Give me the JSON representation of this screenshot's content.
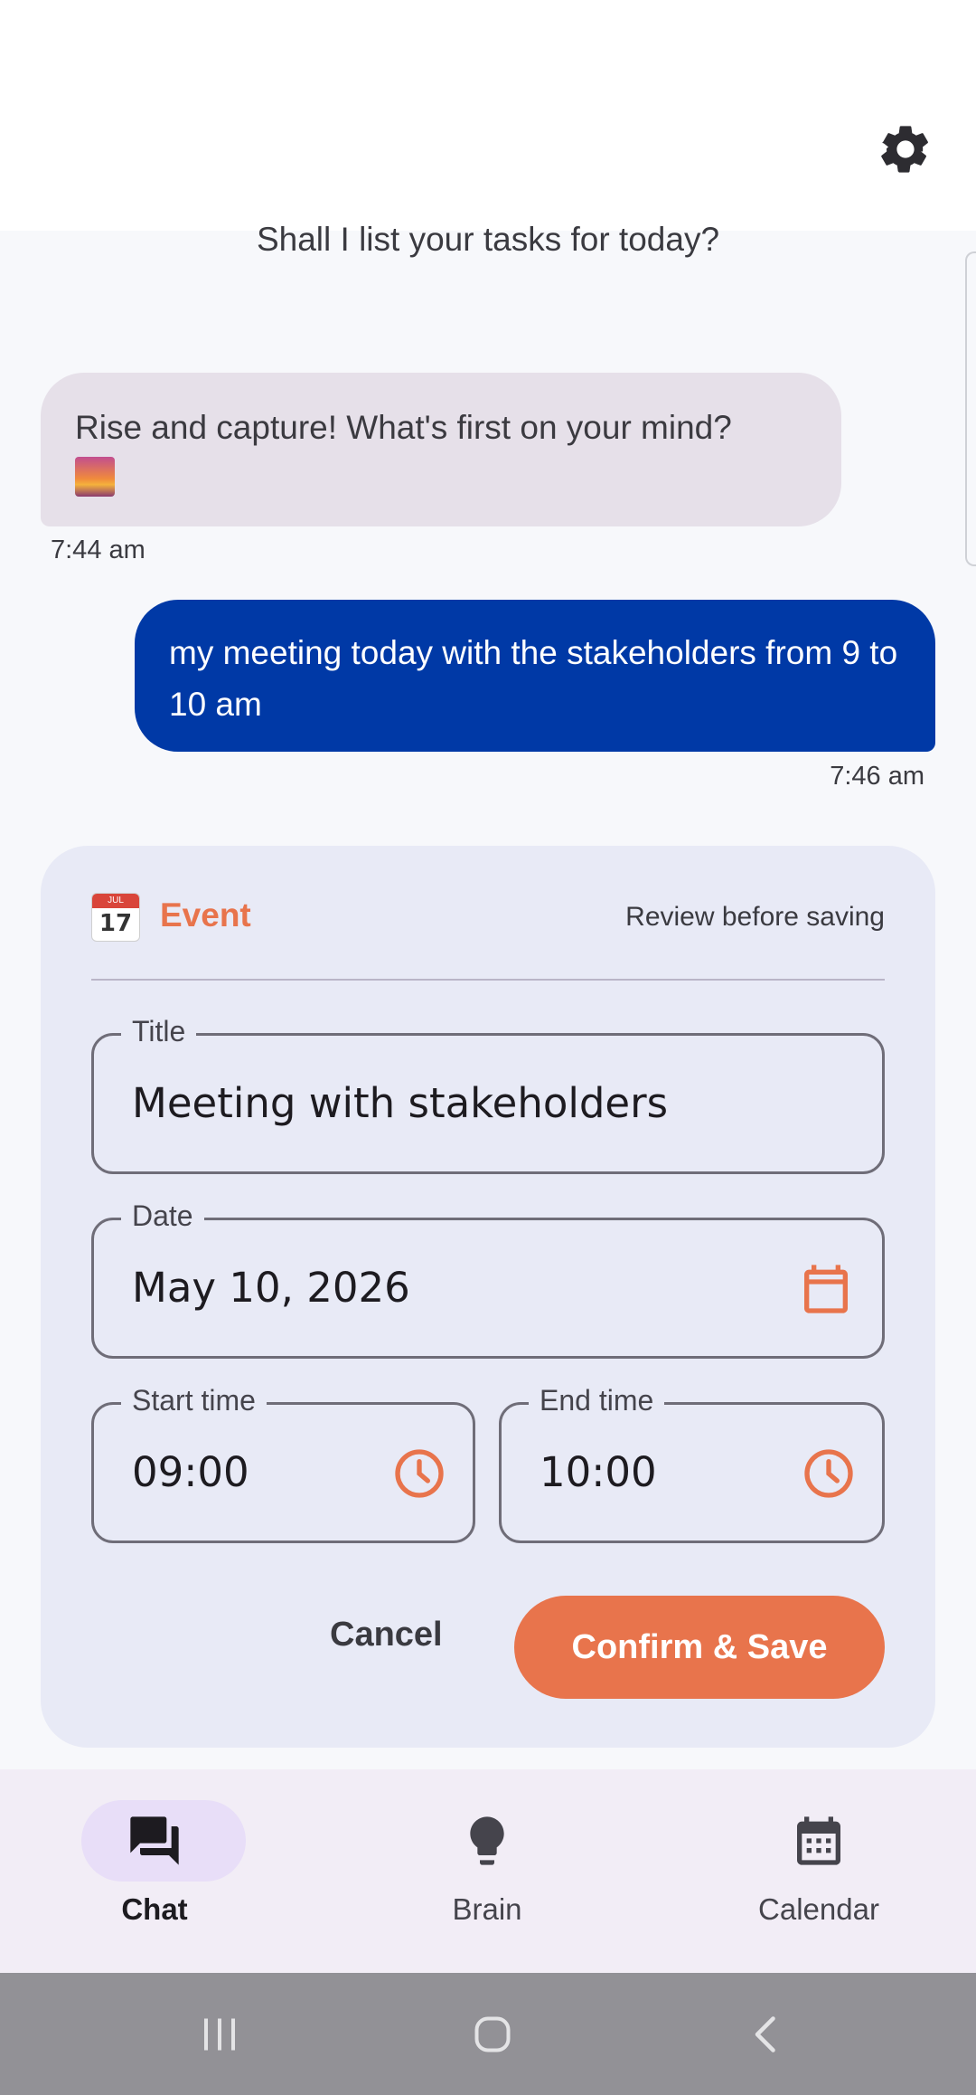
{
  "header": {
    "settings_icon": "gear-icon"
  },
  "chat": {
    "previous_message": "Shall I list your tasks for today?",
    "bot_message": {
      "text": "Rise and capture! What's first on your mind?",
      "emoji": "sunrise-icon",
      "time": "7:44 am"
    },
    "user_message": {
      "text": "my meeting today with the stakeholders from 9 to 10 am",
      "time": "7:46 am"
    }
  },
  "event_card": {
    "type_label": "Event",
    "type_icon": "calendar-emoji-icon",
    "emoji_month": "JUL",
    "emoji_day": "17",
    "review_label": "Review before saving",
    "title": {
      "label": "Title",
      "value": "Meeting with stakeholders"
    },
    "date": {
      "label": "Date",
      "value": "May 10, 2026"
    },
    "start_time": {
      "label": "Start time",
      "value": "09:00"
    },
    "end_time": {
      "label": "End time",
      "value": "10:00"
    },
    "cancel_label": "Cancel",
    "confirm_label": "Confirm & Save",
    "accent_color": "#e8744c"
  },
  "bottom_nav": {
    "items": [
      {
        "label": "Chat",
        "icon": "chat-icon",
        "active": true
      },
      {
        "label": "Brain",
        "icon": "lightbulb-icon",
        "active": false
      },
      {
        "label": "Calendar",
        "icon": "calendar-icon",
        "active": false
      }
    ]
  },
  "system_nav": {
    "recents": "recents-icon",
    "home": "home-icon",
    "back": "back-icon"
  },
  "colors": {
    "user_bubble": "#0039a6",
    "bot_bubble": "#e6e0e9",
    "card_bg": "#e8eaf6",
    "nav_bg": "#f2edf6"
  }
}
